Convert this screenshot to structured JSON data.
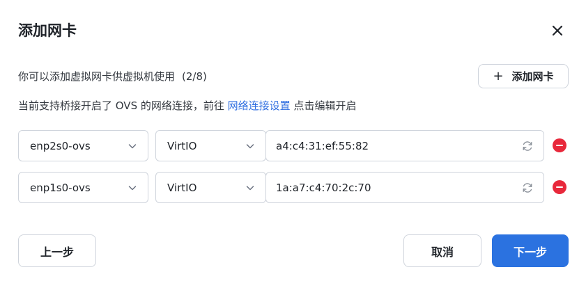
{
  "dialog": {
    "title": "添加网卡",
    "description": "你可以添加虚拟网卡供虚拟机使用",
    "count": "(2/8)",
    "add_button_label": "添加网卡",
    "notice_prefix": "当前支持桥接开启了 OVS 的网络连接，前往",
    "notice_link": "网络连接设置",
    "notice_suffix": "点击编辑开启"
  },
  "nics": [
    {
      "interface": "enp2s0-ovs",
      "model": "VirtIO",
      "mac": "a4:c4:31:ef:55:82"
    },
    {
      "interface": "enp1s0-ovs",
      "model": "VirtIO",
      "mac": "1a:a7:c4:70:2c:70"
    }
  ],
  "footer": {
    "prev_label": "上一步",
    "cancel_label": "取消",
    "next_label": "下一步"
  },
  "colors": {
    "primary": "#2b72e0",
    "link": "#2f6ee0",
    "danger": "#e8283b",
    "border": "#cfd4dc"
  },
  "icons": {
    "close": "close-icon",
    "add": "plus-icon",
    "dropdown": "chevron-down-icon",
    "refresh": "refresh-icon",
    "remove": "remove-circle-icon"
  }
}
